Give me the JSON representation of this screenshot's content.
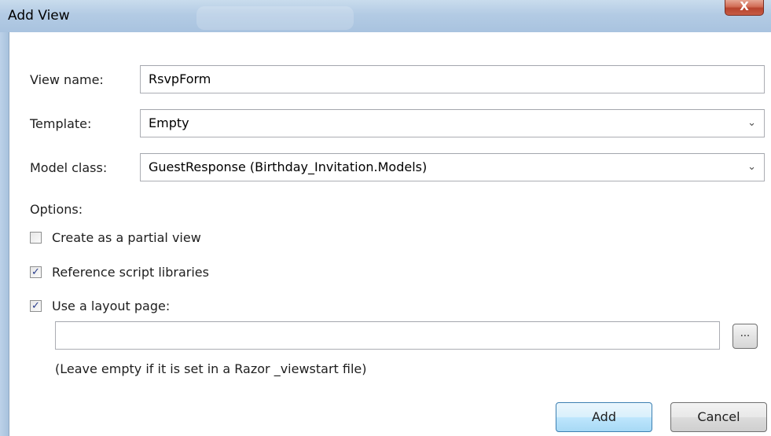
{
  "window": {
    "title": "Add View",
    "close_label": "X"
  },
  "form": {
    "view_name": {
      "label": "View name:",
      "value": "RsvpForm"
    },
    "template": {
      "label": "Template:",
      "value": "Empty"
    },
    "model_class": {
      "label": "Model class:",
      "value": "GuestResponse (Birthday_Invitation.Models)"
    },
    "options_label": "Options:",
    "partial_view": {
      "label": "Create as a partial view",
      "checked": false
    },
    "reference_scripts": {
      "label": "Reference script libraries",
      "checked": true
    },
    "use_layout": {
      "label": "Use a layout page:",
      "checked": true
    },
    "layout_path": {
      "value": ""
    },
    "browse_label": "...",
    "hint": "(Leave empty if it is set in a Razor _viewstart file)"
  },
  "buttons": {
    "add": "Add",
    "cancel": "Cancel"
  },
  "icons": {
    "dropdown": "chevron-down-icon",
    "checkmark": "checkmark-icon"
  }
}
